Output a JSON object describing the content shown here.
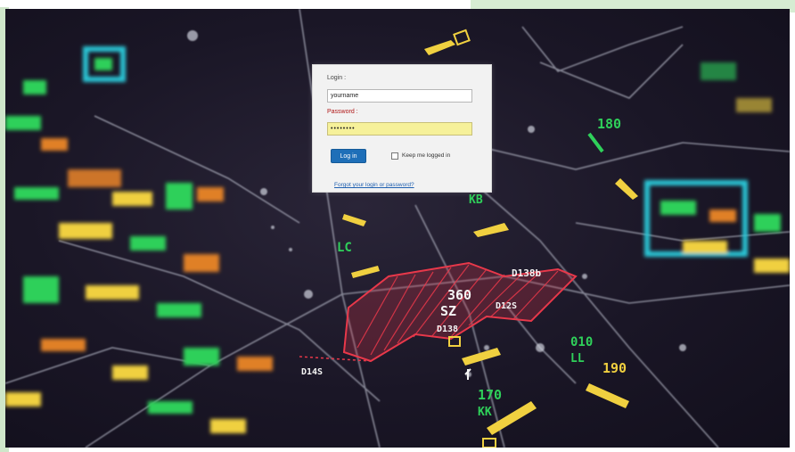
{
  "login_form": {
    "login_label": "Login :",
    "username_value": "yourname",
    "password_label": "Password :",
    "password_value": "••••••••",
    "login_button": "Log in",
    "keep_logged_in": "Keep me logged in",
    "forgot_link": "Forgot your login or password?",
    "keep_logged_in_checked": false
  },
  "radar_labels": [
    "180",
    "KB",
    "LC",
    "360",
    "SZ",
    "D138b",
    "D12S",
    "D138",
    "D14S",
    "190",
    "170",
    "KK",
    "010",
    "LL"
  ],
  "colors": {
    "button": "#1e6fb8",
    "password_highlight": "#f6f19a",
    "radar_red": "#e8384a",
    "radar_green": "#2fd05a",
    "radar_yellow": "#f0d040",
    "radar_cyan": "#2ac8d8"
  }
}
